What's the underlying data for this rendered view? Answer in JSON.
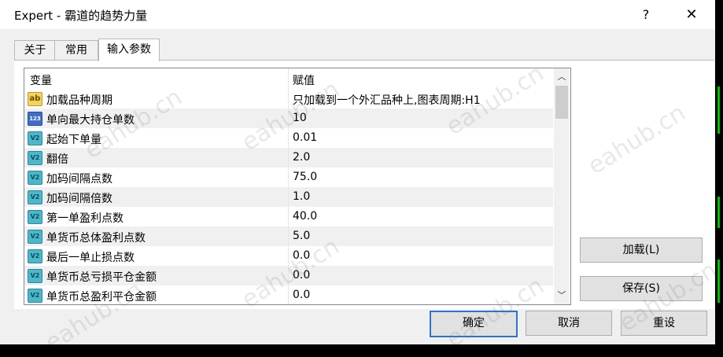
{
  "window": {
    "title": "Expert - 霸道的趋势力量",
    "help": "?",
    "close": "✕"
  },
  "tabs": [
    {
      "label": "关于",
      "active": false
    },
    {
      "label": "常用",
      "active": false
    },
    {
      "label": "输入参数",
      "active": true
    }
  ],
  "table": {
    "headers": {
      "variable": "变量",
      "value": "赋值"
    },
    "rows": [
      {
        "icon": "ab",
        "icon_text": "ab",
        "name": "加载品种周期",
        "value": "只加载到一个外汇品种上,图表周期:H1"
      },
      {
        "icon": "int",
        "icon_text": "123",
        "name": "单向最大持仓单数",
        "value": "10"
      },
      {
        "icon": "dbl",
        "icon_text": "V2",
        "name": "起始下单量",
        "value": "0.01"
      },
      {
        "icon": "dbl",
        "icon_text": "V2",
        "name": "翻倍",
        "value": "2.0"
      },
      {
        "icon": "dbl",
        "icon_text": "V2",
        "name": "加码间隔点数",
        "value": "75.0"
      },
      {
        "icon": "dbl",
        "icon_text": "V2",
        "name": "加码间隔倍数",
        "value": "1.0"
      },
      {
        "icon": "dbl",
        "icon_text": "V2",
        "name": "第一单盈利点数",
        "value": "40.0"
      },
      {
        "icon": "dbl",
        "icon_text": "V2",
        "name": "单货币总体盈利点数",
        "value": "5.0"
      },
      {
        "icon": "dbl",
        "icon_text": "V2",
        "name": "最后一单止损点数",
        "value": "0.0"
      },
      {
        "icon": "dbl",
        "icon_text": "V2",
        "name": "单货币总亏损平仓金额",
        "value": "0.0"
      },
      {
        "icon": "dbl",
        "icon_text": "V2",
        "name": "单货币总盈利平仓金额",
        "value": "0.0"
      }
    ]
  },
  "scrollbar": {
    "up": "︿",
    "down": "﹀"
  },
  "buttons": {
    "load": "加载(L)",
    "save": "保存(S)",
    "ok": "确定",
    "cancel": "取消",
    "reset": "重设"
  },
  "watermark": "eahub.cn",
  "colors": {
    "accent": "#2a74d0",
    "chart_line": "#00c000"
  }
}
